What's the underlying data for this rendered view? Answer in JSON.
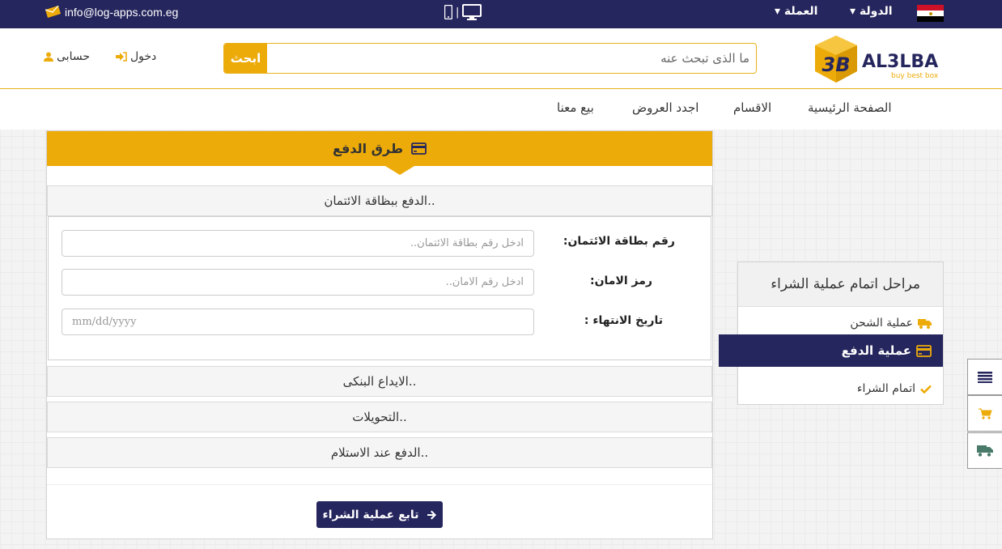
{
  "topbar": {
    "email": "info@log-apps.com.eg",
    "separator": "|",
    "country_label": "الدولة",
    "currency_label": "العملة"
  },
  "brand": {
    "logo_text": "AL3LBA",
    "tagline": "buy best box",
    "mark": "3B"
  },
  "search": {
    "button_label": "ابحث",
    "placeholder": "ما الذى تبحث عنه"
  },
  "account": {
    "login_label": "دخول",
    "account_label": "حسابى"
  },
  "nav": {
    "items": [
      {
        "label": "الصفحة الرئيسية"
      },
      {
        "label": "الاقسام"
      },
      {
        "label": "اجدد العروض"
      },
      {
        "label": "بيع معنا"
      }
    ]
  },
  "payment": {
    "title": "طرق الدفع",
    "sections": [
      {
        "label": "الدفع ببظاقة الائتمان.."
      },
      {
        "label": "الايداع البنكى.."
      },
      {
        "label": "التحويلات.."
      },
      {
        "label": "الدفع عند الاستلام.."
      }
    ],
    "form": {
      "card_number_label": "رقم بطاقة الائتمان:",
      "card_number_placeholder": "ادخل رقم بطاقة الائتمان..",
      "security_code_label": "رمز الامان:",
      "security_code_placeholder": "ادخل رقم الامان..",
      "expiry_label": "تاريخ الانتهاء :",
      "expiry_placeholder": "mm/dd/yyyy"
    },
    "continue_label": "تابع عملية الشراء"
  },
  "steps": {
    "title": "مراحل اتمام عملية الشراء",
    "items": [
      {
        "label": "عملية الشحن",
        "icon": "truck-icon"
      },
      {
        "label": "عملية الدفع",
        "icon": "credit-card-icon",
        "active": true
      },
      {
        "label": "اتمام الشراء",
        "icon": "check-icon"
      }
    ]
  },
  "colors": {
    "navy": "#26265e",
    "gold": "#edab09"
  }
}
